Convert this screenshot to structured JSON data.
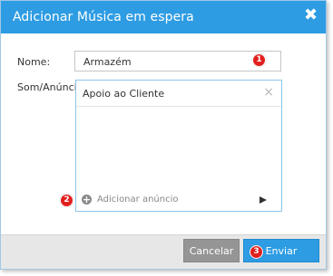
{
  "dialog": {
    "title": "Adicionar Música em espera",
    "close_glyph": "✖"
  },
  "form": {
    "name_label": "Nome:",
    "name_value": "Armazém",
    "ads_label": "Som/Anúncio"
  },
  "ads": {
    "items": [
      {
        "label": "Apoio ao Cliente",
        "remove_glyph": "×"
      }
    ],
    "add_label": "Adicionar anúncio",
    "add_glyph": "+"
  },
  "footer": {
    "cancel_label": "Cancelar",
    "send_label": "Enviar"
  },
  "badges": {
    "one": "1",
    "two": "2",
    "three": "3"
  },
  "colors": {
    "accent": "#2d9ce3",
    "badge": "#e1201e",
    "cancel_button": "#959595",
    "footer_bg": "#e7e7e7"
  }
}
